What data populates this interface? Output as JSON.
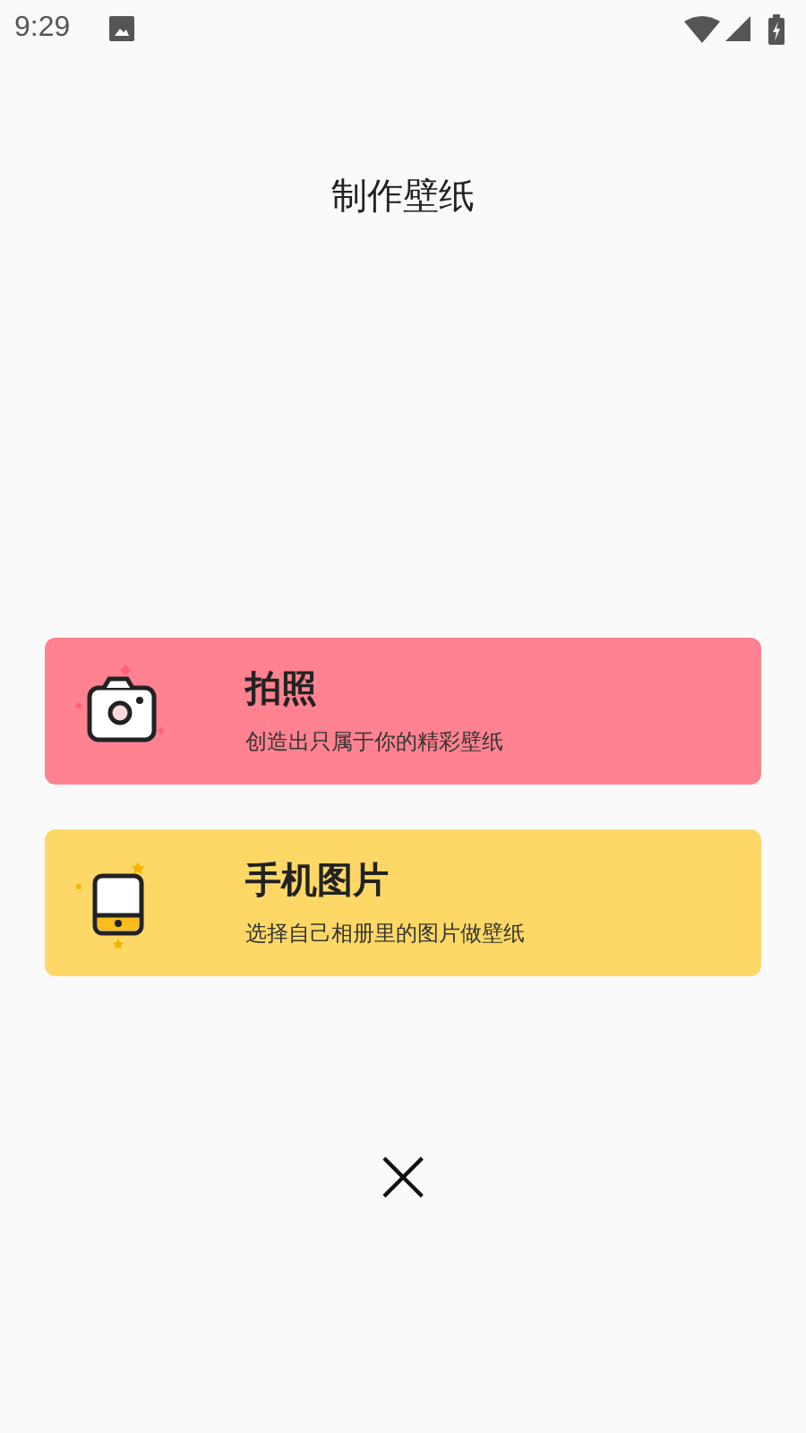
{
  "status_bar": {
    "time": "9:29"
  },
  "title": "制作壁纸",
  "options": [
    {
      "kind": "camera",
      "title": "拍照",
      "subtitle": "创造出只属于你的精彩壁纸",
      "color": "#ff8290"
    },
    {
      "kind": "phone",
      "title": "手机图片",
      "subtitle": "选择自己相册里的图片做壁纸",
      "color": "#fed866"
    }
  ],
  "close": {
    "label": "×"
  }
}
